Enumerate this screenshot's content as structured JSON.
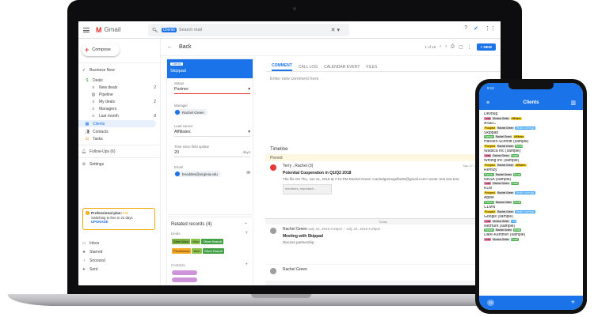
{
  "gmail": {
    "app_name": "Gmail",
    "search_pill": "Clients",
    "search_placeholder": "Search mail",
    "compose_label": "Compose",
    "back_label": "Back",
    "pager": "1 of 16",
    "new_button": "+ NEW"
  },
  "sidebar": {
    "workspace": "Business New",
    "items": [
      {
        "label": "Deals",
        "count": ""
      },
      {
        "label": "New deals",
        "count": "2"
      },
      {
        "label": "Pipeline",
        "count": ""
      },
      {
        "label": "My deals",
        "count": "2"
      },
      {
        "label": "Managers",
        "count": ""
      },
      {
        "label": "Last month",
        "count": "9"
      },
      {
        "label": "Clients",
        "count": ""
      },
      {
        "label": "Contacts",
        "count": ""
      },
      {
        "label": "Tasks",
        "count": ""
      },
      {
        "label": "Follow-Ups (6)",
        "count": ""
      },
      {
        "label": "Settings",
        "count": ""
      }
    ],
    "promo": {
      "title": "Professional plan:",
      "status": "trial",
      "text": "Switching to free in 21 days",
      "upgrade": "UPGRADE"
    },
    "mail_items": [
      "Inbox",
      "Starred",
      "Snoozed",
      "Sent"
    ]
  },
  "entity": {
    "tag": "Clients",
    "name": "Skippad",
    "fields": [
      {
        "label": "Status",
        "value": "Partner"
      },
      {
        "label": "Manager",
        "value": "Rachel Green"
      },
      {
        "label": "Lead source",
        "value": "Affiliates"
      },
      {
        "label": "Time since field update",
        "value": "20",
        "unit": "days"
      },
      {
        "label": "Email",
        "value": "bnoddes@virginia.edu"
      }
    ]
  },
  "related": {
    "title": "Related records (4)",
    "deals_label": "Deals",
    "deal1": {
      "name": "Steel Wool",
      "stage": "Won",
      "owner": "Oliver Brandt"
    },
    "deal2": {
      "name": "Proofhones",
      "stage": "Won",
      "owner": "Oliver Brandt"
    },
    "contacts_label": "Contacts"
  },
  "composer": {
    "tabs": [
      "COMMENT",
      "CALL LOG",
      "CALENDAR EVENT",
      "FILES"
    ],
    "placeholder": "Enter new comment here"
  },
  "timeline": {
    "title": "Timeline",
    "pinned": "Pinned",
    "today": "Today",
    "entries": [
      {
        "who": "Terry , Rachel  (3)",
        "date": "Sep 27, 2018 4:47 PM",
        "title": "Potential Cooperation in Q1/Q2 2018",
        "body": "The file On Thu, Jun 21, 2018 at 7:10 PM Rachel Green <rachelgreengelfar94@gmail.com> wrote: test test test",
        "attachment": "members_important..."
      },
      {
        "who": "Rachel Green",
        "date": "July 22, 2019 3:25pm – July 22, 2019 4:25pm",
        "title": "Meeting with Skippad",
        "body": "Discuss partnership"
      },
      {
        "who": "Rachel Green",
        "date": "",
        "title": "",
        "body": ""
      }
    ]
  },
  "phone": {
    "time": "9:12",
    "title": "Clients",
    "badge": "16",
    "clients": [
      {
        "name": "Devbug",
        "tags": [
          "Lead",
          "Monica Geller",
          "Affiliates"
        ]
      },
      {
        "name": "AISEC",
        "tags": [
          "Prospect",
          "Rachel Green",
          "Media coverage"
        ]
      },
      {
        "name": "Skippad",
        "tags": [
          "Partner",
          "Rachel Green",
          "Affiliates"
        ]
      },
      {
        "name": "Hansen-Schmitt (sample)",
        "tags": [
          "Prospect",
          "Rachel Green",
          "Email"
        ]
      },
      {
        "name": "Watsica Inc (sample)",
        "tags": [
          "Lead",
          "Rachel Green",
          "Email"
        ]
      },
      {
        "name": "Writing Inc (sample)",
        "tags": [
          "Prospect",
          "Rachel Green",
          "Affiliates"
        ]
      },
      {
        "name": "Remizy",
        "tags": [
          "Partner",
          "Rachel Green",
          "Email"
        ]
      },
      {
        "name": "NASA (sample)",
        "tags": [
          "Lead",
          "Rachel Green",
          "Email"
        ]
      },
      {
        "name": "KLM",
        "tags": [
          "Prospect",
          "Rachel Green",
          "Media coverage"
        ]
      },
      {
        "name": "Apple",
        "tags": [
          "Partner",
          "Monica Geller",
          "Email"
        ]
      },
      {
        "name": "CLMN",
        "tags": [
          "Prospect",
          "Rachel Green",
          "Media coverage"
        ]
      },
      {
        "name": "Google (sample)",
        "tags": [
          "Lead",
          "Monica Geller",
          "Call"
        ]
      },
      {
        "name": "NetHunt (sample)",
        "tags": [
          "Partner",
          "Rachel Green",
          "Email"
        ]
      },
      {
        "name": "Dare-Kemmer (sample)",
        "tags": [
          "Lead",
          "Monica Geller",
          "Email"
        ]
      }
    ]
  },
  "colors": {
    "accent": "#1a73e8",
    "gmail_red": "#d93025",
    "promo_border": "#f2a600"
  }
}
